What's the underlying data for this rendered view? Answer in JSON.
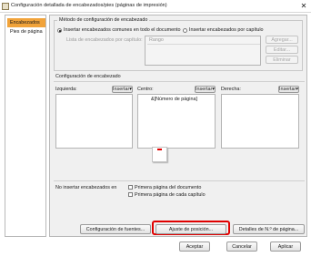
{
  "window": {
    "title": "Configuración detallada de encabezados/pies (páginas de impresión)",
    "close_glyph": "✕"
  },
  "nav": {
    "items": [
      {
        "label": "Encabezados",
        "selected": true
      },
      {
        "label": "Pies de página",
        "selected": false
      }
    ]
  },
  "method": {
    "legend": "Método de configuración de encabezado",
    "option_common": "Insertar encabezados comunes en todo el documento",
    "option_chapter": "Insertar encabezados por capítulo",
    "list_label": "Lista de encabezados por capítulo:",
    "range_header": "Rango",
    "add_button": "Agregar...",
    "edit_button": "Editar...",
    "delete_button": "Eliminar"
  },
  "header_config": {
    "legend": "Configuración de encabezado",
    "left_label": "Izquierda:",
    "center_label": "Centro:",
    "right_label": "Derecha:",
    "insert_button": "Insertar▾",
    "left_value": "",
    "center_value": "&[Número de página]",
    "right_value": ""
  },
  "no_insert": {
    "label": "No insertar encabezados en",
    "first_doc_page": "Primera página del documento",
    "first_chapter_page": "Primera página de cada capítulo"
  },
  "bottom_buttons": {
    "font_config": "Configuración de fuentes...",
    "position_adjust": "Ajuste de posición...",
    "page_number_details": "Detalles de N.º de página..."
  },
  "dialog_buttons": {
    "accept": "Aceptar",
    "cancel": "Cancelar",
    "apply": "Aplicar"
  },
  "colors": {
    "nav_selected": "#f1a33a",
    "highlight_border": "#e00000",
    "page_marker": "#e00000"
  }
}
